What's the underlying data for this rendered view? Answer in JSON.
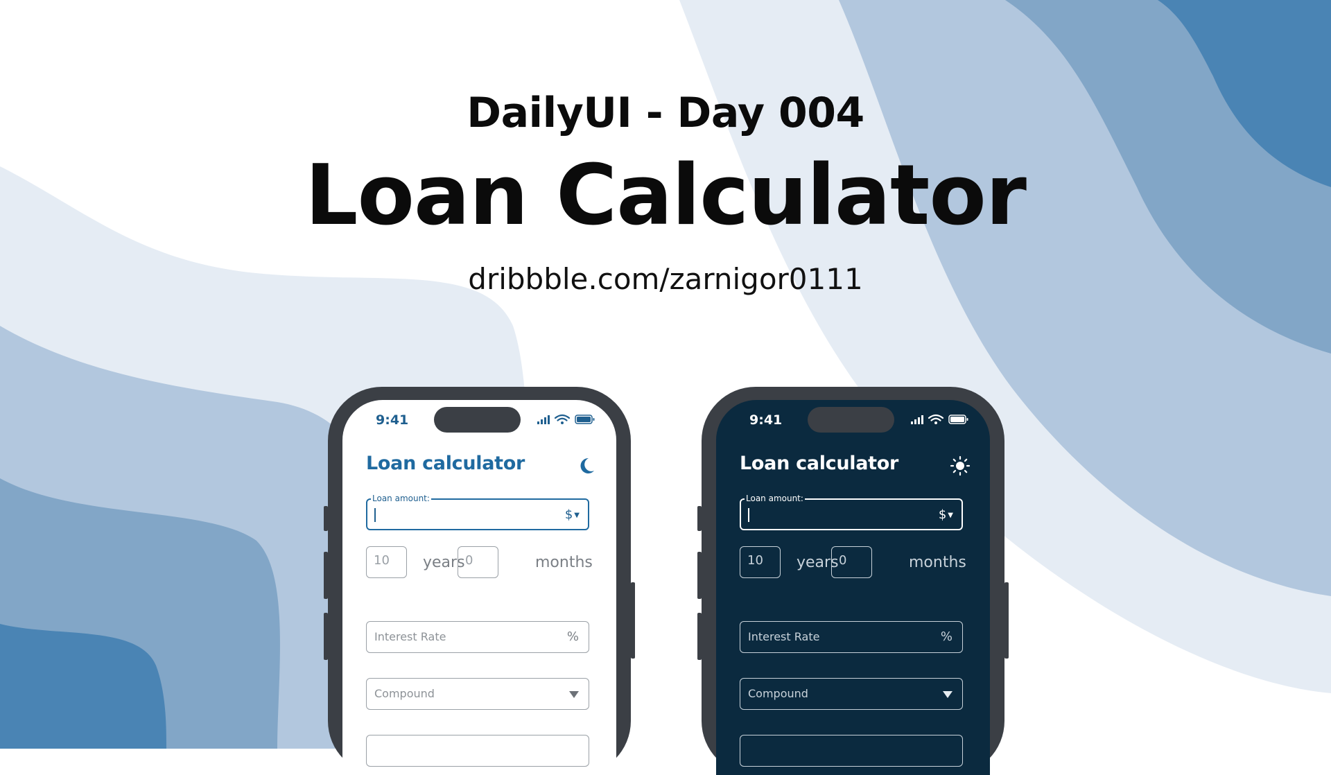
{
  "header": {
    "subtitle": "DailyUI - Day 004",
    "title": "Loan Calculator",
    "url": "dribbble.com/zarnigor0111"
  },
  "colors": {
    "accent": "#1f6aa0",
    "dark_screen": "#0b2a3f",
    "phone_frame": "#3b3f45",
    "wave_1": "#e5ecf4",
    "wave_2": "#b2c7de",
    "wave_3": "#82a6c7",
    "wave_4": "#4a84b4"
  },
  "phones": {
    "light": {
      "status_time": "9:41",
      "app_title": "Loan calculator",
      "theme_icon": "moon-icon",
      "loan_amount_label": "Loan amount:",
      "currency": "$",
      "years_value": "10",
      "years_label": "years",
      "months_value": "0",
      "months_label": "months",
      "interest_placeholder": "Interest Rate",
      "interest_suffix": "%",
      "compound_placeholder": "Compound"
    },
    "dark": {
      "status_time": "9:41",
      "app_title": "Loan calculator",
      "theme_icon": "sun-icon",
      "loan_amount_label": "Loan amount:",
      "currency": "$",
      "years_value": "10",
      "years_label": "years",
      "months_value": "0",
      "months_label": "months",
      "interest_placeholder": "Interest Rate",
      "interest_suffix": "%",
      "compound_placeholder": "Compound"
    }
  }
}
